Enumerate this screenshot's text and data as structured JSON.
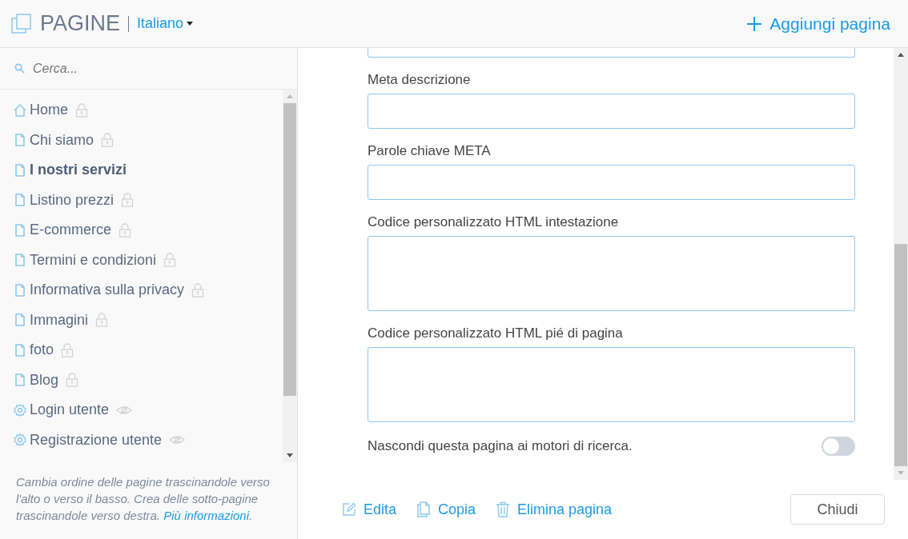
{
  "header": {
    "title": "PAGINE",
    "language": "Italiano",
    "add_button": "Aggiungi pagina"
  },
  "sidebar": {
    "search": {
      "placeholder": "Cerca..."
    },
    "items": [
      {
        "label": "Home",
        "kind": "home",
        "locked": true,
        "hidden": false,
        "selected": false
      },
      {
        "label": "Chi siamo",
        "kind": "page",
        "locked": true,
        "hidden": false,
        "selected": false
      },
      {
        "label": "I nostri servizi",
        "kind": "page",
        "locked": false,
        "hidden": false,
        "selected": true
      },
      {
        "label": "Listino prezzi",
        "kind": "page",
        "locked": true,
        "hidden": false,
        "selected": false
      },
      {
        "label": "E-commerce",
        "kind": "page",
        "locked": true,
        "hidden": false,
        "selected": false
      },
      {
        "label": "Termini e condizioni",
        "kind": "page",
        "locked": true,
        "hidden": false,
        "selected": false
      },
      {
        "label": "Informativa sulla privacy",
        "kind": "page",
        "locked": true,
        "hidden": false,
        "selected": false
      },
      {
        "label": "Immagini",
        "kind": "page",
        "locked": true,
        "hidden": false,
        "selected": false
      },
      {
        "label": "foto",
        "kind": "page",
        "locked": true,
        "hidden": false,
        "selected": false
      },
      {
        "label": "Blog",
        "kind": "page",
        "locked": true,
        "hidden": false,
        "selected": false
      },
      {
        "label": "Login utente",
        "kind": "system",
        "locked": false,
        "hidden": true,
        "selected": false
      },
      {
        "label": "Registrazione utente",
        "kind": "system",
        "locked": false,
        "hidden": true,
        "selected": false
      }
    ],
    "help": {
      "text": "Cambia ordine delle pagine trascinandole verso l'alto o verso il basso. Crea delle sotto-pagine trascinandole verso destra.",
      "link": "Più informazioni",
      "end": "."
    }
  },
  "form": {
    "fields": [
      {
        "label": "Meta descrizione",
        "kind": "line"
      },
      {
        "label": "Parole chiave META",
        "kind": "line"
      },
      {
        "label": "Codice personalizzato HTML intestazione",
        "kind": "area"
      },
      {
        "label": "Codice personalizzato HTML pié di pagina",
        "kind": "area"
      }
    ],
    "toggle": {
      "label": "Nascondi questa pagina ai motori di ricerca.",
      "on": false
    }
  },
  "footer": {
    "actions": [
      {
        "label": "Edita",
        "kind": "edit"
      },
      {
        "label": "Copia",
        "kind": "copy"
      },
      {
        "label": "Elimina pagina",
        "kind": "delete"
      }
    ],
    "close": "Chiudi"
  }
}
